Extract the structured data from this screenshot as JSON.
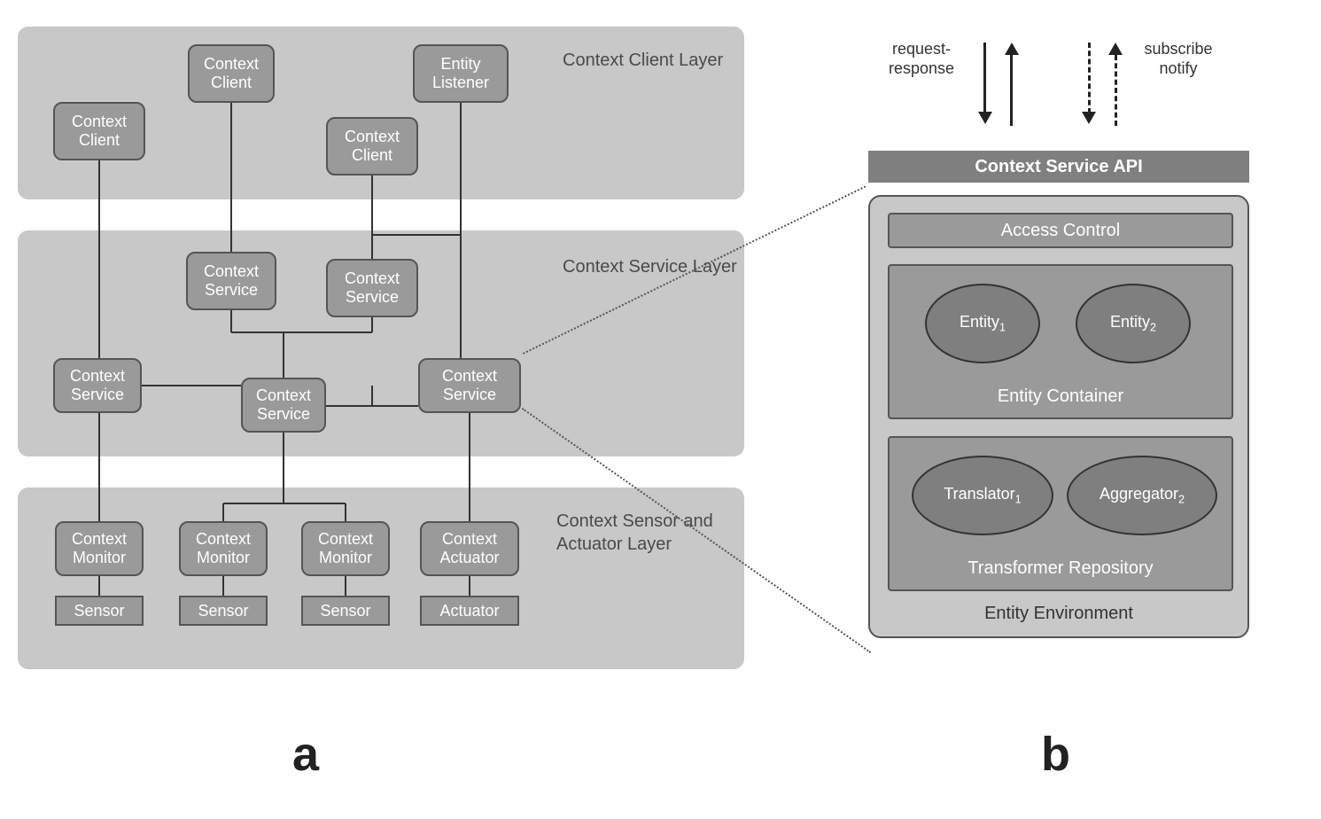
{
  "panelA": {
    "layers": {
      "client": "Context Client Layer",
      "service": "Context Service Layer",
      "sensor": "Context Sensor and Actuator Layer"
    },
    "nodes": {
      "cc1": "Context Client",
      "cc2": "Context Client",
      "el": "Entity Listener",
      "cc3": "Context Client",
      "cs1": "Context Service",
      "cs2": "Context Service",
      "cs3": "Context Service",
      "cs4": "Context Service",
      "cs5": "Context Service",
      "cm1": "Context Monitor",
      "cm2": "Context Monitor",
      "cm3": "Context Monitor",
      "ca": "Context Actuator",
      "s1": "Sensor",
      "s2": "Sensor",
      "s3": "Sensor",
      "act": "Actuator"
    }
  },
  "panelB": {
    "labels": {
      "reqres": "request-\nresponse",
      "subnot": "subscribe\nnotify",
      "api": "Context Service API",
      "access": "Access Control",
      "env": "Entity Environment",
      "container": "Entity Container",
      "repo": "Transformer Repository",
      "e1": "Entity",
      "e1sub": "1",
      "e2": "Entity",
      "e2sub": "2",
      "tr": "Translator",
      "trsub": "1",
      "ag": "Aggregator",
      "agsub": "2"
    }
  },
  "letters": {
    "a": "a",
    "b": "b"
  }
}
